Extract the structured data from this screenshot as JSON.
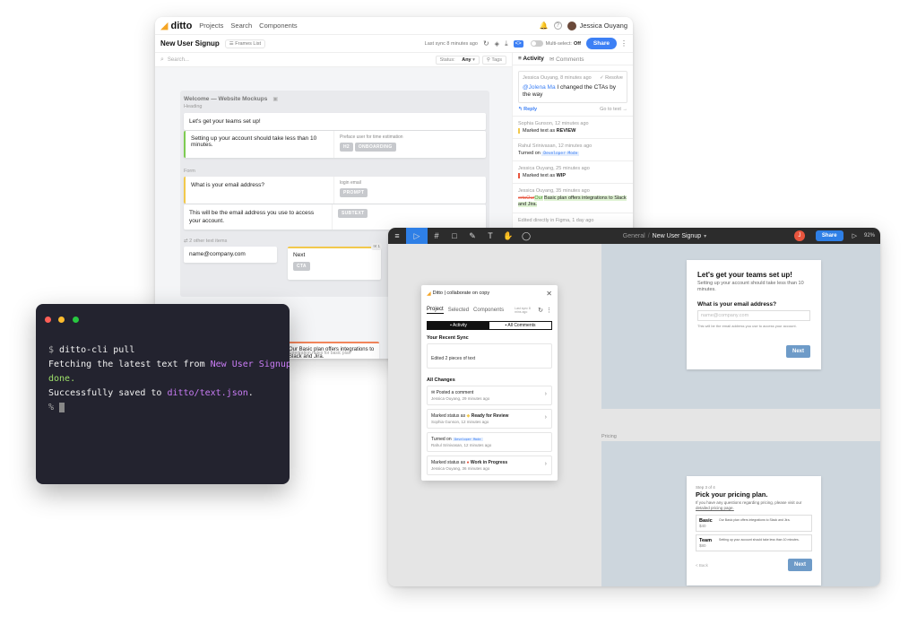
{
  "ditto": {
    "logo": "ditto",
    "nav": [
      "Projects",
      "Search",
      "Components"
    ],
    "user": "Jessica Ouyang",
    "doc_title": "New User Signup",
    "frames_list": "Frames List",
    "last_sync": "Last sync 8 minutes ago",
    "multi_select_label": "Multi-select:",
    "multi_select_value": "Off",
    "share": "Share",
    "search_placeholder": "Search...",
    "status_label": "Status:",
    "status_value": "Any",
    "tags": "Tags",
    "tabs": {
      "activity": "Activity",
      "comments": "Comments"
    },
    "group_title": "Welcome — Website Mockups",
    "heading_label": "Heading",
    "heading_text": "Let's get your teams set up!",
    "sub_text": "Setting up your account should take less than 10 minutes.",
    "sub_note": "Preface user for time estimation",
    "sub_tags": [
      "H2",
      "ONBOARDING"
    ],
    "form_label": "Form",
    "email_q": "What is your email address?",
    "email_note": "login email",
    "email_tag": "PROMPT",
    "email_desc": "This will be the email address you use to access your account.",
    "email_desc_tag": "SUBTEXT",
    "other_items": "2 other text items",
    "input_text": "name@company.com",
    "next_text": "Next",
    "next_tag": "CTA",
    "next_count": "1",
    "plan_text": "Our Basic plan offers integrations to Slack and Jira.",
    "plan_note": "Integration notes for basic plan",
    "activity": {
      "comment_meta": "Jessica Ouyang, 8 minutes ago",
      "resolve": "Resolve",
      "mention": "@Jolena Ma",
      "comment_text": "I changed the CTAs by the way",
      "reply": "Reply",
      "go_to_text": "Go to text",
      "e1_meta": "Sophia Gunson, 12 minutes ago",
      "e1_prefix": "Marked text as",
      "e1_value": "REVIEW",
      "e2_meta": "Rahul Srinivasan, 12 minutes ago",
      "e2_prefix": "Turned on",
      "e2_value": "Developer Mode",
      "e3_meta": "Jessica Ouyang, 25 minutes ago",
      "e3_prefix": "Marked text as",
      "e3_value": "WIP",
      "e4_meta": "Jessica Ouyang, 35 minutes ago",
      "e4_del": "ertsOur",
      "e4_ins": "Our",
      "e4_text": "Basic plan offers integrations to Slack and Jira.",
      "e5_meta": "Edited directly in Figma, 1 day ago"
    }
  },
  "terminal": {
    "lines": [
      {
        "prompt": "$ ",
        "text": "ditto-cli pull"
      },
      {
        "text": "Fetching the latest text from ",
        "highlight": "New User Signup",
        "suffix": "..."
      },
      {
        "green": "done."
      },
      {
        "text": "Successfully saved to ",
        "highlight": "ditto/text.json",
        "suffix": "."
      },
      {
        "prompt": "% "
      }
    ]
  },
  "figma": {
    "breadcrumb_team": "General",
    "breadcrumb_sep": "/",
    "breadcrumb_file": "New User Signup",
    "avatar": "J",
    "share": "Share",
    "zoom": "92%",
    "plugin": {
      "title": "Ditto | collaborate on copy",
      "tabs": [
        "Project",
        "Selected",
        "Components"
      ],
      "last_sync": "Last sync 8 mins ago",
      "toggle": [
        "Activity",
        "All Comments"
      ],
      "recent_sync_title": "Your Recent Sync",
      "recent_sync_text": "Edited 2 pieces of text",
      "all_changes_title": "All Changes",
      "changes": [
        {
          "title": "Posted a comment",
          "meta": "Jessica Ouyang, 29 minutes ago"
        },
        {
          "title": "Marked status as",
          "status": "Ready for Review",
          "meta": "Sophia Gunson, 12 minutes ago"
        },
        {
          "title": "Turned on",
          "status": "Developer Mode",
          "meta": "Rahul Srinivasan, 12 minutes ago"
        },
        {
          "title": "Marked status as",
          "status": "Work in Progress",
          "meta": "Jessica Ouyang, 36 minutes ago"
        }
      ]
    },
    "frame1": {
      "heading": "Let's get your teams set up!",
      "sub": "Setting up your account should take less than 10 minutes.",
      "question": "What is your email address?",
      "placeholder": "name@company.com",
      "hint": "This will be the email address you use to access your account.",
      "button": "Next"
    },
    "pricing_label": "Pricing",
    "frame2": {
      "step": "Step 3 of 4",
      "heading": "Pick your pricing plan.",
      "sub": "If you have any questions regarding pricing, please visit our",
      "link": "detailed pricing page.",
      "plans": [
        {
          "name": "Basic",
          "price": "$40",
          "desc": "Our Basic plan offers integrations to Slack and Jira."
        },
        {
          "name": "Team",
          "price": "$80",
          "desc": "Setting up your account should take less than 10 minutes."
        }
      ],
      "back": "< Back",
      "button": "Next"
    }
  }
}
